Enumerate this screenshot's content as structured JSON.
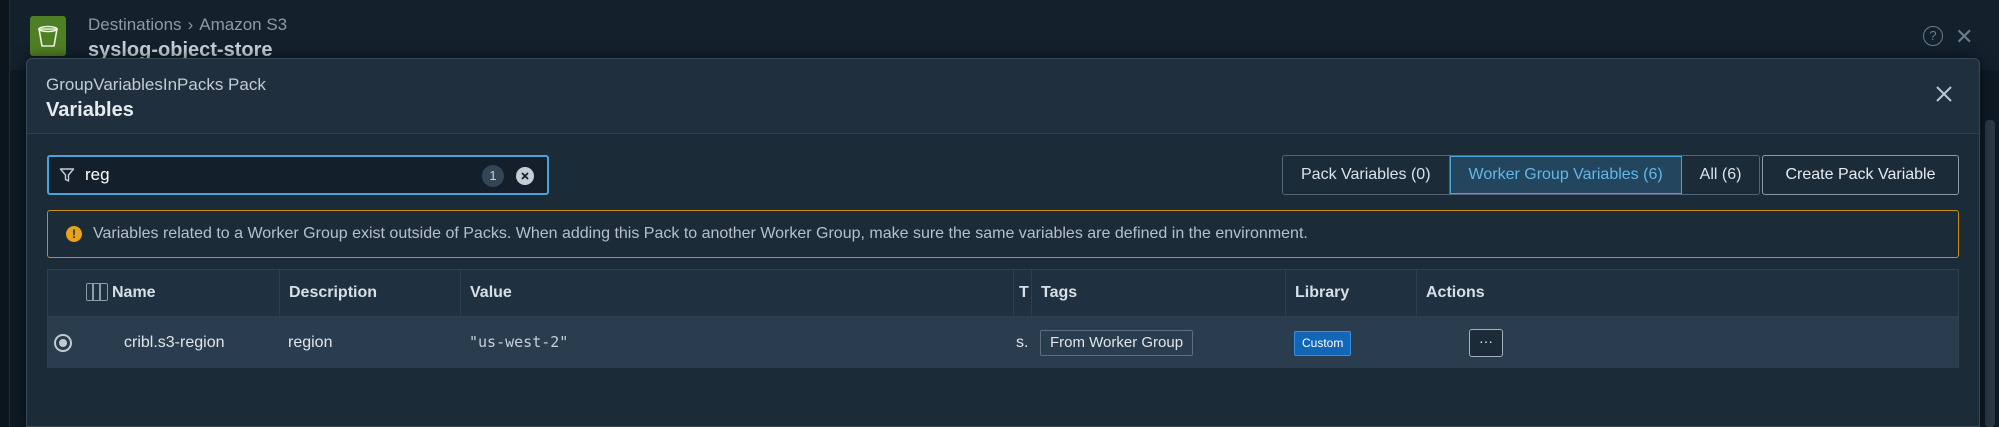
{
  "background": {
    "breadcrumb": [
      "Destinations",
      "Amazon S3"
    ],
    "breadcrumb_sep": "›",
    "title": "syslog-object-store",
    "help_label": "?"
  },
  "modal": {
    "subtitle": "GroupVariablesInPacks Pack",
    "title": "Variables"
  },
  "search": {
    "value": "reg",
    "match_count": "1"
  },
  "filters": [
    {
      "label": "Pack Variables (0)",
      "active": false
    },
    {
      "label": "Worker Group Variables (6)",
      "active": true
    },
    {
      "label": "All (6)",
      "active": false
    }
  ],
  "create_button_label": "Create Pack Variable",
  "warning": {
    "icon": "!",
    "text": "Variables related to a Worker Group exist outside of Packs. When adding this Pack to another Worker Group, make sure the same variables are defined in the environment."
  },
  "table": {
    "columns": [
      "Name",
      "Description",
      "Value",
      "T",
      "Tags",
      "Library",
      "Actions"
    ],
    "rows": [
      {
        "name": "cribl.s3-region",
        "description": "region",
        "value": "\"us-west-2\"",
        "type": "s.",
        "tag": "From Worker Group",
        "library": "Custom",
        "actions_label": "···"
      }
    ]
  },
  "colors": {
    "accent": "#4aa3d8",
    "warning": "#e8a317",
    "library_badge": "#1266b8"
  }
}
